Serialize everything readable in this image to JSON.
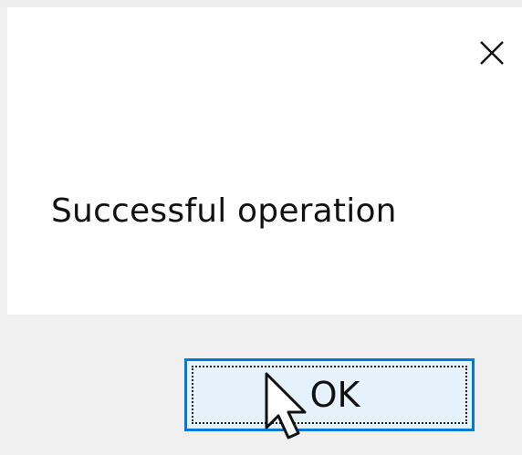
{
  "dialog": {
    "message": "Successful operation",
    "ok_label": "OK",
    "close_icon": "close-icon",
    "cursor_icon": "mouse-pointer-icon"
  },
  "colors": {
    "content_background": "#ffffff",
    "footer_background": "#f0f0f0",
    "button_border": "#0078d7",
    "button_background": "#e5f1fb",
    "text": "#111111"
  }
}
